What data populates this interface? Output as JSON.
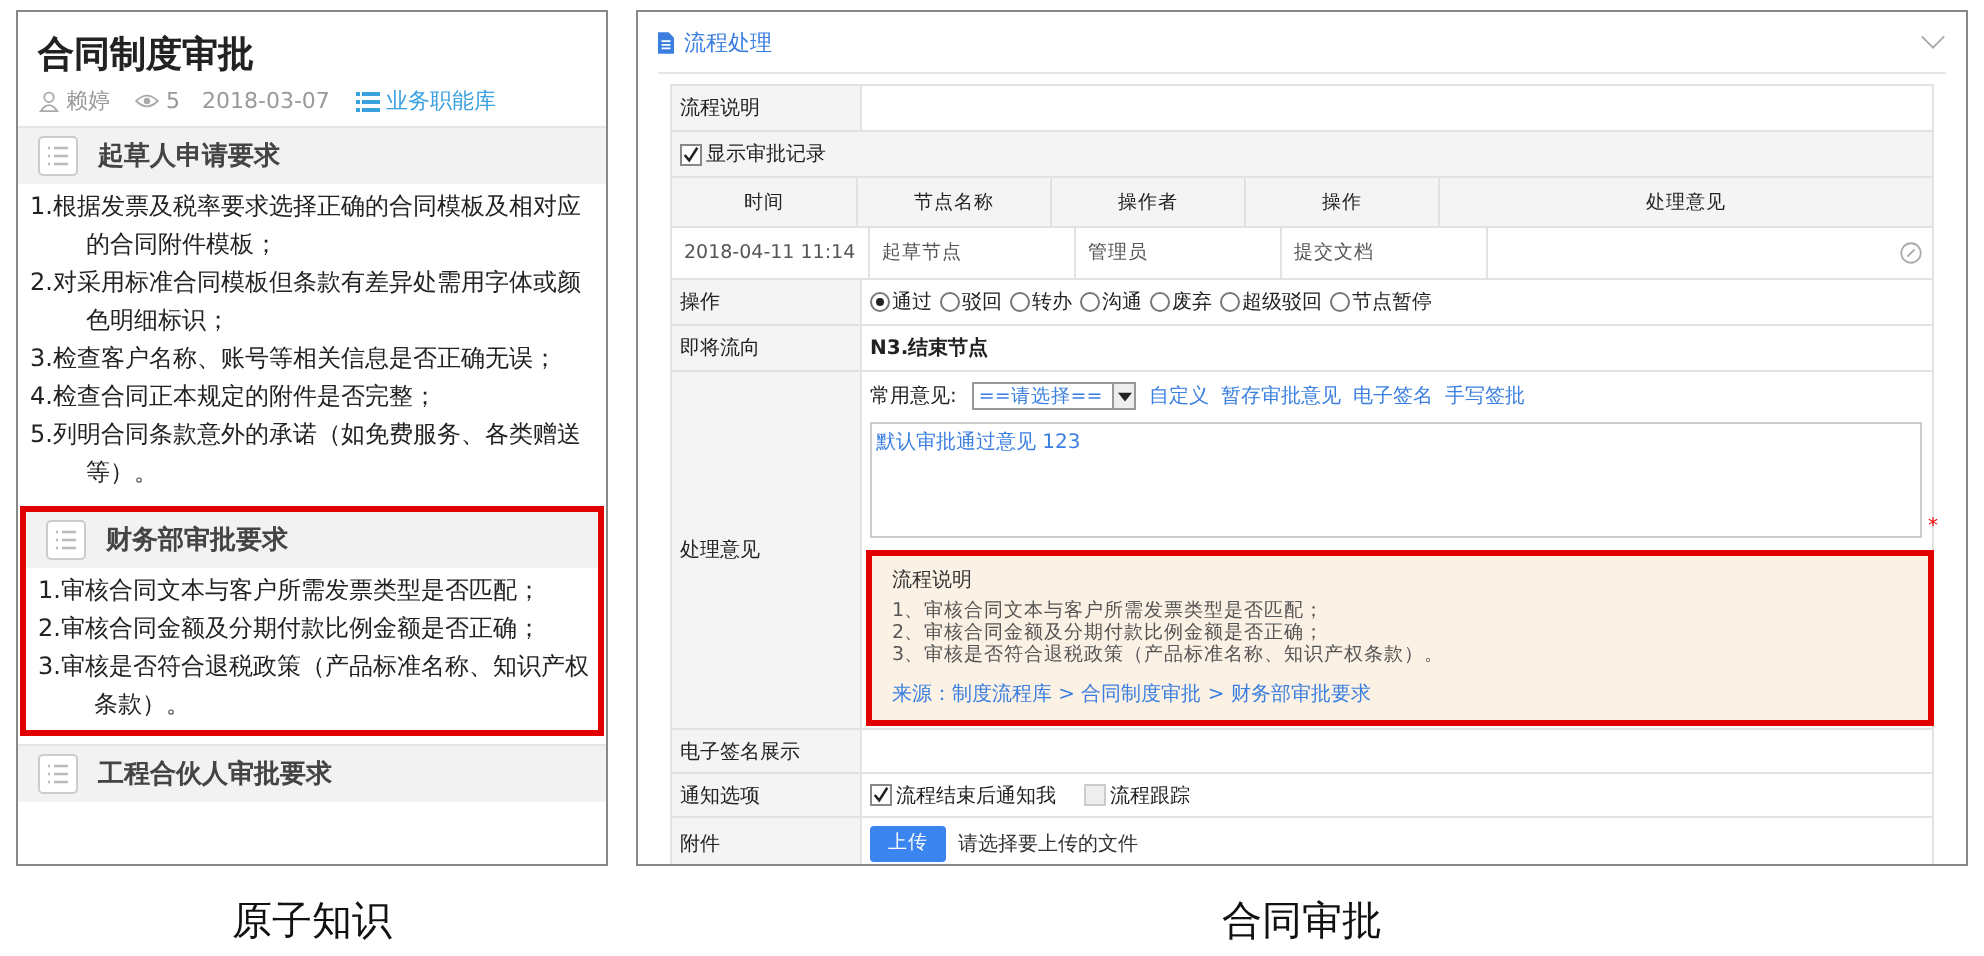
{
  "knowledge_card": {
    "title": "合同制度审批",
    "author": "赖婷",
    "views": "5",
    "date": "2018-03-07",
    "category": "业务职能库",
    "sections": [
      {
        "title": "起草人申请要求",
        "highlighted": false,
        "items": [
          "1.根据发票及税率要求选择正确的合同模板及相对应的合同附件模板；",
          "2.对采用标准合同模板但条款有差异处需用字体或颜色明细标识；",
          "3.检查客户名称、账号等相关信息是否正确无误；",
          "4.检查合同正本规定的附件是否完整；",
          "5.列明合同条款意外的承诺（如免费服务、各类赠送等）。"
        ]
      },
      {
        "title": "财务部审批要求",
        "highlighted": true,
        "items": [
          "1.审核合同文本与客户所需发票类型是否匹配；",
          "2.审核合同金额及分期付款比例金额是否正确；",
          "3.审核是否符合退税政策（产品标准名称、知识产权条款）。"
        ]
      },
      {
        "title": "工程合伙人审批要求",
        "highlighted": false
      }
    ],
    "caption": "原子知识"
  },
  "approval_form": {
    "title": "流程处理",
    "description_label": "流程说明",
    "show_records": {
      "label": "显示审批记录",
      "checked": true
    },
    "records": {
      "columns": [
        "时间",
        "节点名称",
        "操作者",
        "操作",
        "处理意见"
      ],
      "rows": [
        [
          "2018-04-11 11:14",
          "起草节点",
          "管理员",
          "提交文档"
        ]
      ]
    },
    "operation": {
      "label": "操作",
      "options": [
        {
          "label": "通过",
          "selected": true
        },
        {
          "label": "驳回",
          "selected": false
        },
        {
          "label": "转办",
          "selected": false
        },
        {
          "label": "沟通",
          "selected": false
        },
        {
          "label": "废弃",
          "selected": false
        },
        {
          "label": "超级驳回",
          "selected": false
        },
        {
          "label": "节点暂停",
          "selected": false
        }
      ]
    },
    "next_step": {
      "label": "即将流向",
      "value": "N3.结束节点"
    },
    "opinion": {
      "label": "处理意见",
      "common_label": "常用意见:",
      "select_value": "==请选择==",
      "links": [
        "自定义",
        "暂存审批意见",
        "电子签名",
        "手写签批"
      ],
      "text": "默认审批通过意见 123",
      "required_mark": "*",
      "note": {
        "title": "流程说明",
        "highlighted": true,
        "lines": [
          "1、审核合同文本与客户所需发票类型是否匹配；",
          "2、审核合同金额及分期付款比例金额是否正确；",
          "3、审核是否符合退税政策（产品标准名称、知识产权条款）。"
        ],
        "source": "来源：制度流程库 > 合同制度审批 > 财务部审批要求"
      }
    },
    "signature_label": "电子签名展示",
    "notify": {
      "label": "通知选项",
      "options": [
        {
          "label": "流程结束后通知我",
          "checked": true
        },
        {
          "label": "流程跟踪",
          "checked": false
        }
      ]
    },
    "attachment": {
      "label": "附件",
      "button": "上传",
      "hint": "请选择要上传的文件"
    },
    "caption": "合同审批"
  }
}
